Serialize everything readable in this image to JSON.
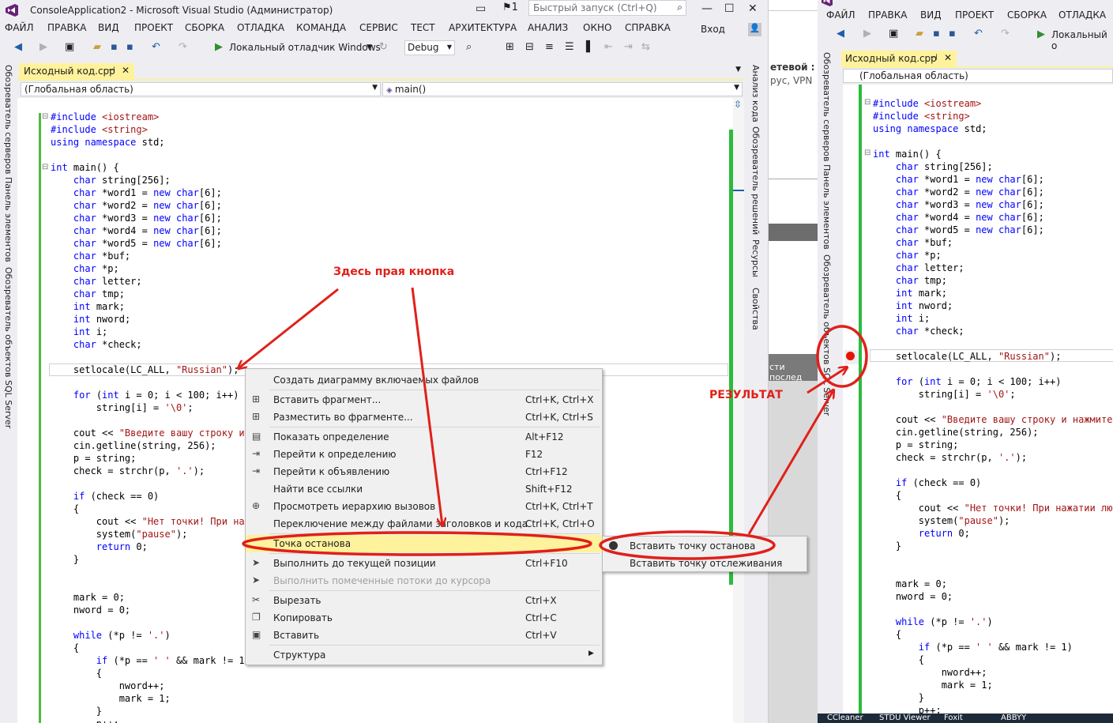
{
  "window": {
    "title": "ConsoleApplication2 - Microsoft Visual Studio (Администратор)",
    "flag_count": "1",
    "quick_launch_placeholder": "Быстрый запуск (Ctrl+Q)",
    "login": "Вход"
  },
  "menu": [
    "ФАЙЛ",
    "ПРАВКА",
    "ВИД",
    "ПРОЕКТ",
    "СБОРКА",
    "ОТЛАДКА",
    "КОМАНДА",
    "СЕРВИС",
    "ТЕСТ",
    "АРХИТЕКТУРА",
    "АНАЛИЗ",
    "ОКНО",
    "СПРАВКА"
  ],
  "toolbar": {
    "run_label": "Локальный отладчик Windows",
    "config": "Debug"
  },
  "left_panels": [
    "Обозреватель серверов",
    "Панель элементов",
    "Обозреватель объектов SQL Server"
  ],
  "right_panels": [
    "Анализ кода",
    "Обозреватель решений",
    "Ресурсы",
    "Свойства"
  ],
  "tab": {
    "label": "Исходный код.cpp",
    "pin": "⊣",
    "close": "✕"
  },
  "nav": {
    "scope": "(Глобальная область)",
    "member": "main()"
  },
  "code_lines": [
    "#include <iostream>",
    "#include <string>",
    "using namespace std;",
    "",
    "int main() {",
    "    char string[256];",
    "    char *word1 = new char[6];",
    "    char *word2 = new char[6];",
    "    char *word3 = new char[6];",
    "    char *word4 = new char[6];",
    "    char *word5 = new char[6];",
    "    char *buf;",
    "    char *p;",
    "    char letter;",
    "    char tmp;",
    "    int mark;",
    "    int nword;",
    "    int i;",
    "    char *check;",
    "",
    "    setlocale(LC_ALL, \"Russian\");",
    "",
    "    for (int i = 0; i < 100; i++)",
    "        string[i] = '\\0';",
    "",
    "    cout << \"Введите вашу строку и",
    "    cin.getline(string, 256);",
    "    p = string;",
    "    check = strchr(p, '.');",
    "",
    "    if (check == 0)",
    "    {",
    "        cout << \"Нет точки! При наж",
    "        system(\"pause\");",
    "        return 0;",
    "    }",
    "",
    "",
    "    mark = 0;",
    "    nword = 0;",
    "",
    "    while (*p != '.')",
    "    {",
    "        if (*p == ' ' && mark != 1)",
    "        {",
    "            nword++;",
    "            mark = 1;",
    "        }",
    "        p++;"
  ],
  "context_menu": [
    {
      "label": "Создать диаграмму включаемых файлов",
      "shortcut": "",
      "icon": "",
      "disabled": false
    },
    {
      "label": "Вставить фрагмент...",
      "shortcut": "Ctrl+K, Ctrl+X",
      "icon": "snippet-icon",
      "disabled": false
    },
    {
      "label": "Разместить во фрагменте...",
      "shortcut": "Ctrl+K, Ctrl+S",
      "icon": "surround-icon",
      "disabled": false
    },
    {
      "label": "Показать определение",
      "shortcut": "Alt+F12",
      "icon": "peek-icon",
      "disabled": false
    },
    {
      "label": "Перейти к определению",
      "shortcut": "F12",
      "icon": "goto-def-icon",
      "disabled": false
    },
    {
      "label": "Перейти к объявлению",
      "shortcut": "Ctrl+F12",
      "icon": "goto-decl-icon",
      "disabled": false
    },
    {
      "label": "Найти все ссылки",
      "shortcut": "Shift+F12",
      "icon": "",
      "disabled": false
    },
    {
      "label": "Просмотреть иерархию вызовов",
      "shortcut": "Ctrl+K, Ctrl+T",
      "icon": "call-hierarchy-icon",
      "disabled": false
    },
    {
      "label": "Переключение между файлами заголовков и кода",
      "shortcut": "Ctrl+K, Ctrl+O",
      "icon": "",
      "disabled": false
    },
    {
      "label": "Точка останова",
      "shortcut": "",
      "icon": "",
      "disabled": false
    },
    {
      "label": "Выполнить до текущей позиции",
      "shortcut": "Ctrl+F10",
      "icon": "cursor-icon",
      "disabled": false
    },
    {
      "label": "Выполнить помеченные потоки до курсора",
      "shortcut": "",
      "icon": "cursor-icon",
      "disabled": true
    },
    {
      "label": "Вырезать",
      "shortcut": "Ctrl+X",
      "icon": "scissors-icon",
      "disabled": false
    },
    {
      "label": "Копировать",
      "shortcut": "Ctrl+C",
      "icon": "copy-icon",
      "disabled": false
    },
    {
      "label": "Вставить",
      "shortcut": "Ctrl+V",
      "icon": "paste-icon",
      "disabled": false
    },
    {
      "label": "Структура",
      "shortcut": "",
      "icon": "",
      "disabled": false
    }
  ],
  "submenu": [
    "Вставить точку останова",
    "Вставить точку отслеживания"
  ],
  "annotations": {
    "right_click": "Здесь прая кнопка",
    "result": "РЕЗУЛЬТАТ"
  },
  "background_window": {
    "line1": "етевой :",
    "line2": "рус, VPN",
    "line3": "сти послед"
  },
  "second_window": {
    "menu": [
      "ФАЙЛ",
      "ПРАВКА",
      "ВИД",
      "ПРОЕКТ",
      "СБОРКА",
      "ОТЛАДКА"
    ],
    "run_label": "Локальный о",
    "left_panels": [
      "Обозреватель серверов",
      "Панель элементов",
      "Обозреватель объектов SQL Server"
    ],
    "code_lines": [
      "#include <iostream>",
      "#include <string>",
      "using namespace std;",
      "",
      "int main() {",
      "    char string[256];",
      "    char *word1 = new char[6];",
      "    char *word2 = new char[6];",
      "    char *word3 = new char[6];",
      "    char *word4 = new char[6];",
      "    char *word5 = new char[6];",
      "    char *buf;",
      "    char *p;",
      "    char letter;",
      "    char tmp;",
      "    int mark;",
      "    int nword;",
      "    int i;",
      "    char *check;",
      "",
      "    setlocale(LC_ALL, \"Russian\");",
      "",
      "    for (int i = 0; i < 100; i++)",
      "        string[i] = '\\0';",
      "",
      "    cout << \"Введите вашу строку и нажмите",
      "    cin.getline(string, 256);",
      "    p = string;",
      "    check = strchr(p, '.');",
      "",
      "    if (check == 0)",
      "    {",
      "        cout << \"Нет точки! При нажатии лю",
      "        system(\"pause\");",
      "        return 0;",
      "    }",
      "",
      "",
      "    mark = 0;",
      "    nword = 0;",
      "",
      "    while (*p != '.')",
      "    {",
      "        if (*p == ' ' && mark != 1)",
      "        {",
      "            nword++;",
      "            mark = 1;",
      "        }",
      "        p++;"
    ],
    "taskbar": [
      "CCleaner",
      "STDU Viewer",
      "Foxit",
      "ABBYY"
    ]
  },
  "colors": {
    "keyword": "#0000ff",
    "string": "#a31515",
    "preproc": "#808080",
    "annotation": "#e0201a",
    "tab_active": "#fff29d",
    "change_bar": "#4fbb3f",
    "breakpoint": "#e51400"
  }
}
